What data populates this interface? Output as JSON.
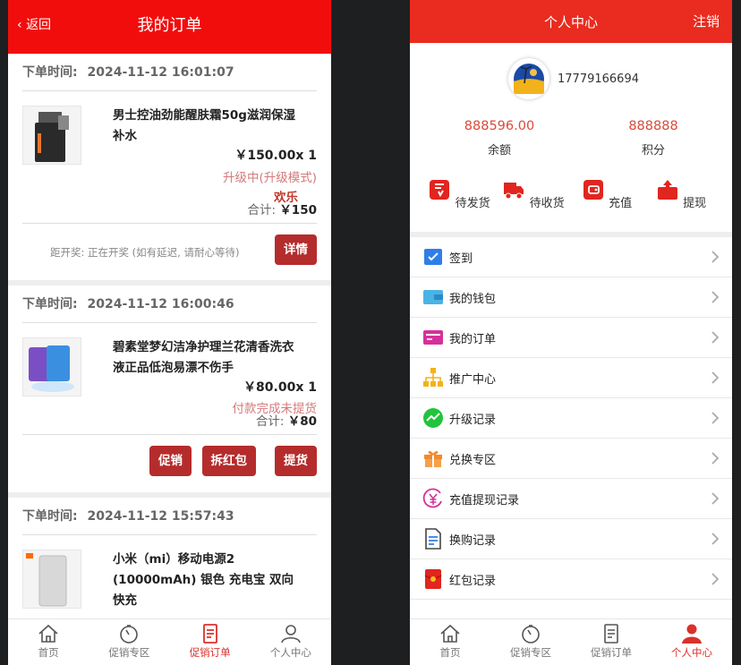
{
  "left": {
    "header": {
      "back_label": "返回",
      "title": "我的订单"
    },
    "orders": [
      {
        "time_label": "下单时间:",
        "time": "2024-11-12 16:01:07",
        "product_name": "男士控油劲能醒肤霜50g滋润保湿补水",
        "price": "￥150.00x 1",
        "status": "升级中(升级模式)",
        "status2": "欢乐",
        "total_label": "合计:",
        "total": "￥150",
        "note": "距开奖: 正在开奖 (如有延迟, 请耐心等待)",
        "buttons": [
          "详情"
        ]
      },
      {
        "time_label": "下单时间:",
        "time": "2024-11-12 16:00:46",
        "product_name": "碧素堂梦幻洁净护理兰花清香洗衣液正品低泡易漂不伤手",
        "price": "￥80.00x 1",
        "status": "付款完成未提货",
        "status2": "",
        "total_label": "合计:",
        "total": "￥80",
        "note": "",
        "buttons": [
          "促销",
          "拆红包",
          "提货"
        ]
      },
      {
        "time_label": "下单时间:",
        "time": "2024-11-12 15:57:43",
        "product_name": "小米（mi）移动电源2 (10000mAh) 银色 充电宝 双向快充",
        "price": "",
        "status": "",
        "status2": "",
        "total_label": "",
        "total": "",
        "note": "",
        "buttons": []
      }
    ],
    "tabs": [
      {
        "label": "首页",
        "icon": "home-icon"
      },
      {
        "label": "促销专区",
        "icon": "timer-icon"
      },
      {
        "label": "促销订单",
        "icon": "order-icon"
      },
      {
        "label": "个人中心",
        "icon": "user-icon"
      }
    ],
    "active_tab": 2
  },
  "right": {
    "header": {
      "title": "个人中心",
      "logout_label": "注销"
    },
    "profile": {
      "phone": "17779166694"
    },
    "stats": [
      {
        "value": "888596.00",
        "label": "余额"
      },
      {
        "value": "888888",
        "label": "积分"
      }
    ],
    "quick": [
      {
        "label": "待发货",
        "icon": "pending-ship-icon"
      },
      {
        "label": "待收货",
        "icon": "truck-icon"
      },
      {
        "label": "充值",
        "icon": "wallet-icon"
      },
      {
        "label": "提现",
        "icon": "withdraw-icon"
      }
    ],
    "menu": [
      {
        "label": "签到",
        "icon": "checkin-icon",
        "color": "#2f7ee8"
      },
      {
        "label": "我的钱包",
        "icon": "wallet-card-icon",
        "color": "#4ab3e6"
      },
      {
        "label": "我的订单",
        "icon": "order-card-icon",
        "color": "#d6309a"
      },
      {
        "label": "推广中心",
        "icon": "org-chart-icon",
        "color": "#f3b21b"
      },
      {
        "label": "升级记录",
        "icon": "trend-icon",
        "color": "#21c43c"
      },
      {
        "label": "兑换专区",
        "icon": "gift-icon",
        "color": "#f28a2c"
      },
      {
        "label": "充值提现记录",
        "icon": "yen-icon",
        "color": "#d6309a"
      },
      {
        "label": "换购记录",
        "icon": "document-icon",
        "color": "#2f7ee8"
      },
      {
        "label": "红包记录",
        "icon": "red-envelope-icon",
        "color": "#e0261f"
      }
    ],
    "tabs": [
      {
        "label": "首页",
        "icon": "home-icon"
      },
      {
        "label": "促销专区",
        "icon": "timer-icon"
      },
      {
        "label": "促销订单",
        "icon": "order-icon"
      },
      {
        "label": "个人中心",
        "icon": "user-icon"
      }
    ],
    "active_tab": 3
  },
  "colors": {
    "header_red": "#f20d0d",
    "button_red": "#b52c2c",
    "active_tab": "#d9312c"
  }
}
